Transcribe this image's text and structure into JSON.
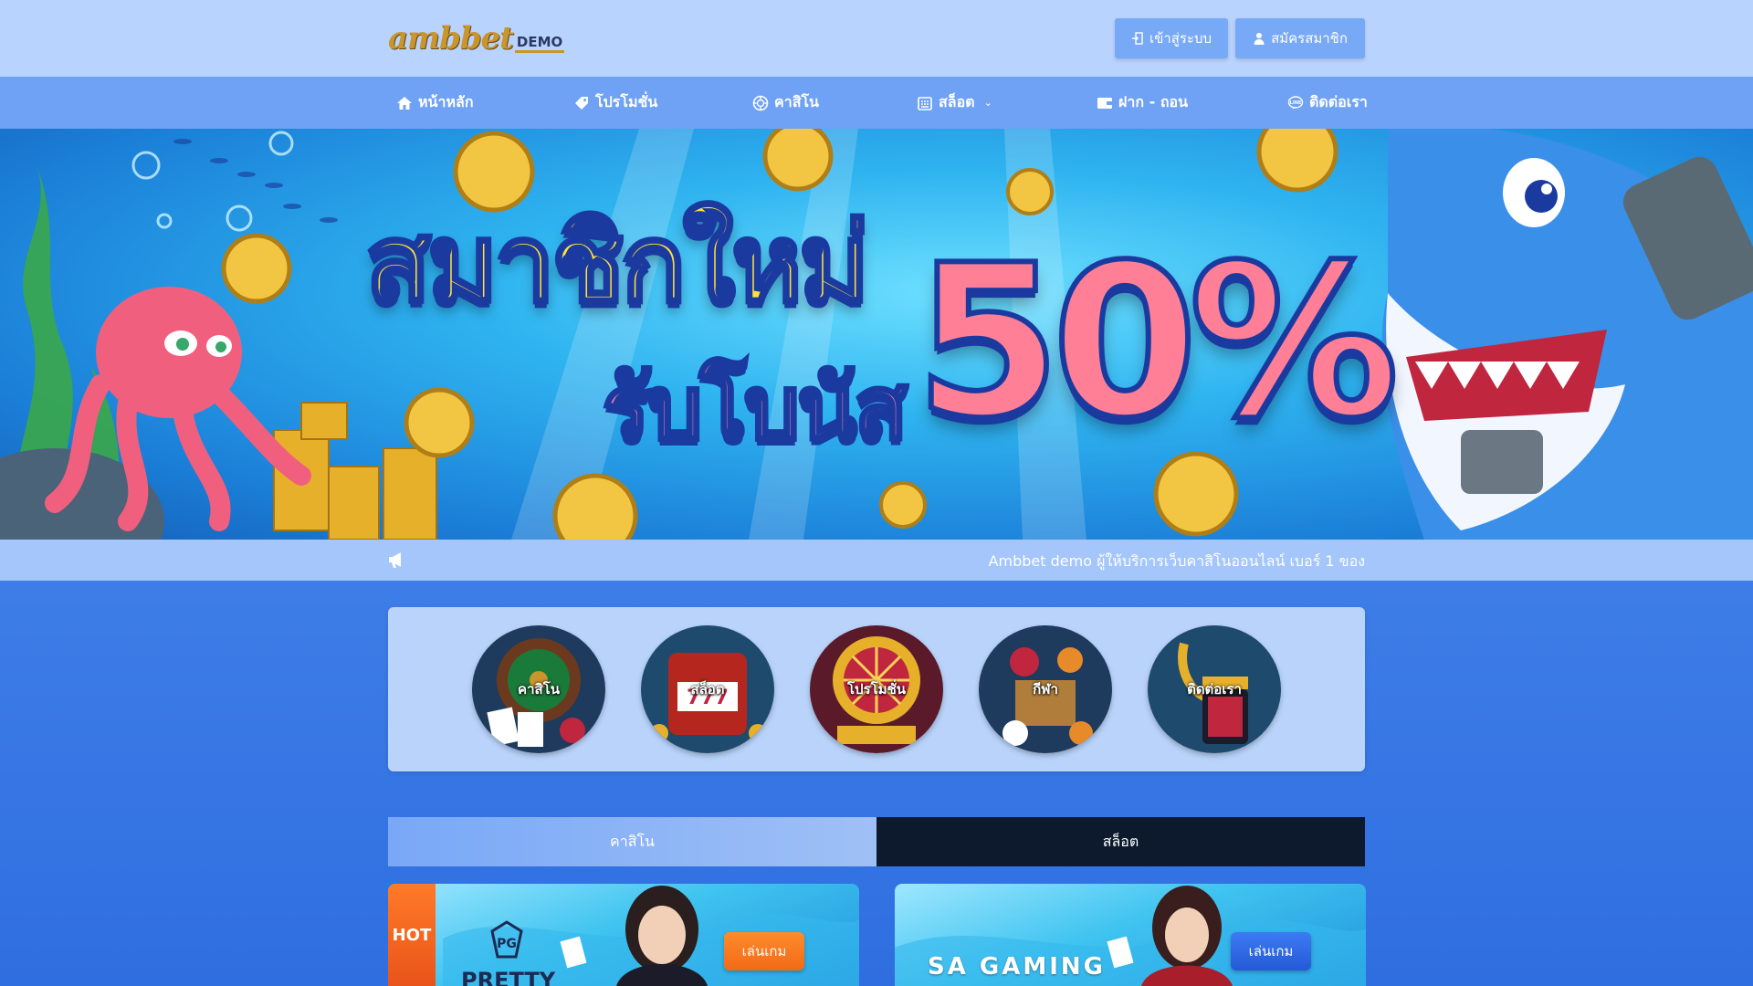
{
  "header": {
    "logo_text": "ambbet",
    "logo_suffix": "DEMO",
    "login_label": "เข้าสู่ระบบ",
    "register_label": "สมัครสมาชิก"
  },
  "nav": {
    "items": [
      {
        "label": "หน้าหลัก",
        "icon": "home-icon"
      },
      {
        "label": "โปรโมชั่น",
        "icon": "tag-icon"
      },
      {
        "label": "คาสิโน",
        "icon": "chip-icon"
      },
      {
        "label": "สล็อต",
        "icon": "slot-icon",
        "has_dropdown": true
      },
      {
        "label": "ฝาก - ถอน",
        "icon": "wallet-icon"
      },
      {
        "label": "ติดต่อเรา",
        "icon": "line-icon"
      }
    ]
  },
  "banner": {
    "title": "สมาชิกใหม่",
    "subtitle": "รับโบนัส",
    "percent": "50%"
  },
  "announcement": {
    "icon": "megaphone-icon",
    "text": "Ambbet demo ผู้ให้บริการเว็บคาสิโนออนไลน์ เบอร์ 1 ของ"
  },
  "categories": [
    {
      "label": "คาสิโน"
    },
    {
      "label": "สล็อต"
    },
    {
      "label": "โปรโมชั่น"
    },
    {
      "label": "กีฬา"
    },
    {
      "label": "ติดต่อเรา"
    }
  ],
  "tabs": [
    {
      "label": "คาสิโน",
      "active": true
    },
    {
      "label": "สล็อต",
      "active": false
    }
  ],
  "games": [
    {
      "badge": "HOT",
      "provider": "PRETTY",
      "play_label": "เล่นเกม"
    },
    {
      "provider": "SA GAMING",
      "play_label": "เล่นเกม"
    }
  ],
  "colors": {
    "topbar": "#b9d3ff",
    "nav": "#6fa2f4",
    "accent_orange": "#f16a16",
    "accent_blue": "#2459d6",
    "tab_dark": "#0d1a2e"
  }
}
